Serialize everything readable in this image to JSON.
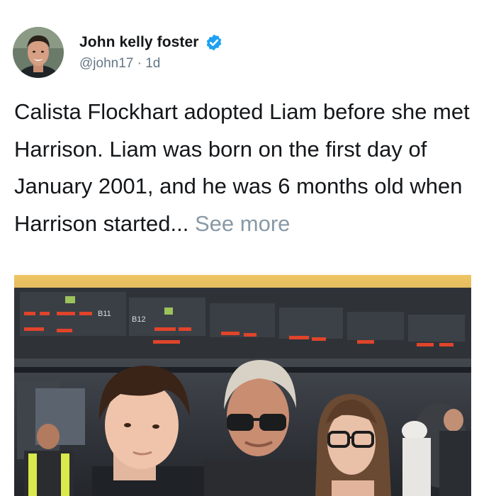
{
  "author": {
    "display_name": "John kelly foster",
    "handle": "@john17",
    "separator": " · ",
    "time_ago": "1d",
    "verified": true
  },
  "tweet": {
    "text": "Calista Flockhart adopted Liam before she met Harrison. Liam was born on the first day of January 2001, and he was 6 months old when Harrison started...",
    "see_more_label": "See more"
  },
  "media": {
    "kind": "photo",
    "signs": {
      "gate_a": "B11",
      "gate_b": "B12"
    }
  },
  "colors": {
    "verified_badge": "#1da1f2",
    "secondary_text": "#657786",
    "see_more": "#8899a6"
  },
  "icons": {
    "verified": "verified-check-icon"
  }
}
